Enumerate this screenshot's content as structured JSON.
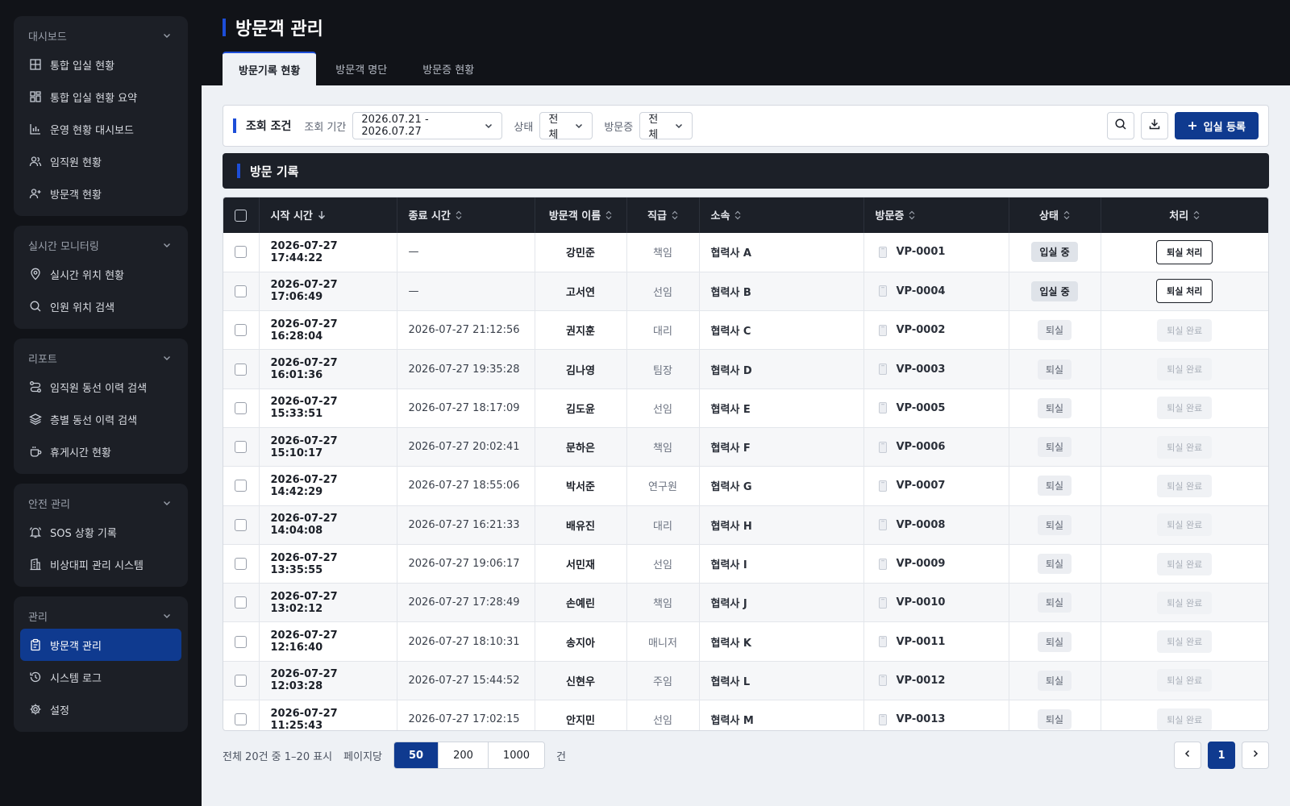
{
  "colors": {
    "accent": "#0f3a8f",
    "accent_bar": "#1d4ed8",
    "sidebar_bg": "#111318",
    "header_dark": "#1c2028"
  },
  "sidebar": {
    "groups": [
      {
        "label": "대시보드",
        "items": [
          {
            "label": "통합 입실 현황",
            "icon": "grid-icon"
          },
          {
            "label": "통합 입실 현황 요약",
            "icon": "layout-icon"
          },
          {
            "label": "운영 현황 대시보드",
            "icon": "bar-chart-icon"
          },
          {
            "label": "임직원 현황",
            "icon": "users-icon"
          },
          {
            "label": "방문객 현황",
            "icon": "user-plus-icon"
          }
        ]
      },
      {
        "label": "실시간 모니터링",
        "items": [
          {
            "label": "실시간 위치 현황",
            "icon": "map-pin-icon"
          },
          {
            "label": "인원 위치 검색",
            "icon": "search-icon"
          }
        ]
      },
      {
        "label": "리포트",
        "items": [
          {
            "label": "임직원 동선 이력 검색",
            "icon": "route-icon"
          },
          {
            "label": "층별 동선 이력 검색",
            "icon": "layers-icon"
          },
          {
            "label": "휴게시간 현황",
            "icon": "coffee-icon"
          }
        ]
      },
      {
        "label": "안전 관리",
        "items": [
          {
            "label": "SOS 상황 기록",
            "icon": "bell-icon"
          },
          {
            "label": "비상대피 관리 시스템",
            "icon": "building-icon"
          }
        ]
      },
      {
        "label": "관리",
        "items": [
          {
            "label": "방문객 관리",
            "icon": "clipboard-icon",
            "active": true
          },
          {
            "label": "시스템 로그",
            "icon": "history-icon"
          },
          {
            "label": "설정",
            "icon": "gear-icon"
          }
        ]
      }
    ]
  },
  "header": {
    "title": "방문객 관리",
    "tabs": [
      {
        "label": "방문기록 현황",
        "active": true
      },
      {
        "label": "방문객 명단"
      },
      {
        "label": "방문증 현황"
      }
    ]
  },
  "filter": {
    "title": "조회 조건",
    "period_label": "조회 기간",
    "period_value": "2026.07.21 - 2026.07.27",
    "status_label": "상태",
    "status_value": "전체",
    "badge_label": "방문증",
    "badge_value": "전체",
    "register_label": "입실 등록"
  },
  "section": {
    "title": "방문 기록"
  },
  "table": {
    "columns": [
      "시작 시간",
      "종료 시간",
      "방문객 이름",
      "직급",
      "소속",
      "방문증",
      "상태",
      "처리"
    ],
    "rows": [
      {
        "start": "2026-07-27 17:44:22",
        "end": "—",
        "name": "강민준",
        "rank": "책임",
        "aff": "협력사 A",
        "badge": "VP-0001",
        "status": "입실 중",
        "action": "퇴실 처리",
        "in": true
      },
      {
        "start": "2026-07-27 17:06:49",
        "end": "—",
        "name": "고서연",
        "rank": "선임",
        "aff": "협력사 B",
        "badge": "VP-0004",
        "status": "입실 중",
        "action": "퇴실 처리",
        "in": true
      },
      {
        "start": "2026-07-27 16:28:04",
        "end": "2026-07-27 21:12:56",
        "name": "권지훈",
        "rank": "대리",
        "aff": "협력사 C",
        "badge": "VP-0002",
        "status": "퇴실",
        "action": "퇴실 완료",
        "in": false
      },
      {
        "start": "2026-07-27 16:01:36",
        "end": "2026-07-27 19:35:28",
        "name": "김나영",
        "rank": "팀장",
        "aff": "협력사 D",
        "badge": "VP-0003",
        "status": "퇴실",
        "action": "퇴실 완료",
        "in": false
      },
      {
        "start": "2026-07-27 15:33:51",
        "end": "2026-07-27 18:17:09",
        "name": "김도윤",
        "rank": "선임",
        "aff": "협력사 E",
        "badge": "VP-0005",
        "status": "퇴실",
        "action": "퇴실 완료",
        "in": false
      },
      {
        "start": "2026-07-27 15:10:17",
        "end": "2026-07-27 20:02:41",
        "name": "문하은",
        "rank": "책임",
        "aff": "협력사 F",
        "badge": "VP-0006",
        "status": "퇴실",
        "action": "퇴실 완료",
        "in": false
      },
      {
        "start": "2026-07-27 14:42:29",
        "end": "2026-07-27 18:55:06",
        "name": "박서준",
        "rank": "연구원",
        "aff": "협력사 G",
        "badge": "VP-0007",
        "status": "퇴실",
        "action": "퇴실 완료",
        "in": false
      },
      {
        "start": "2026-07-27 14:04:08",
        "end": "2026-07-27 16:21:33",
        "name": "배유진",
        "rank": "대리",
        "aff": "협력사 H",
        "badge": "VP-0008",
        "status": "퇴실",
        "action": "퇴실 완료",
        "in": false
      },
      {
        "start": "2026-07-27 13:35:55",
        "end": "2026-07-27 19:06:17",
        "name": "서민재",
        "rank": "선임",
        "aff": "협력사 I",
        "badge": "VP-0009",
        "status": "퇴실",
        "action": "퇴실 완료",
        "in": false
      },
      {
        "start": "2026-07-27 13:02:12",
        "end": "2026-07-27 17:28:49",
        "name": "손예린",
        "rank": "책임",
        "aff": "협력사 J",
        "badge": "VP-0010",
        "status": "퇴실",
        "action": "퇴실 완료",
        "in": false
      },
      {
        "start": "2026-07-27 12:16:40",
        "end": "2026-07-27 18:10:31",
        "name": "송지아",
        "rank": "매니저",
        "aff": "협력사 K",
        "badge": "VP-0011",
        "status": "퇴실",
        "action": "퇴실 완료",
        "in": false
      },
      {
        "start": "2026-07-27 12:03:28",
        "end": "2026-07-27 15:44:52",
        "name": "신현우",
        "rank": "주임",
        "aff": "협력사 L",
        "badge": "VP-0012",
        "status": "퇴실",
        "action": "퇴실 완료",
        "in": false
      },
      {
        "start": "2026-07-27 11:25:43",
        "end": "2026-07-27 17:02:15",
        "name": "안지민",
        "rank": "선임",
        "aff": "협력사 M",
        "badge": "VP-0013",
        "status": "퇴실",
        "action": "퇴실 완료",
        "in": false
      }
    ]
  },
  "footer": {
    "summary": "전체 20건 중 1–20 표시",
    "per_page_label": "페이지당",
    "options": [
      "50",
      "200",
      "1000"
    ],
    "selected": "50",
    "unit": "건",
    "current_page": "1"
  }
}
